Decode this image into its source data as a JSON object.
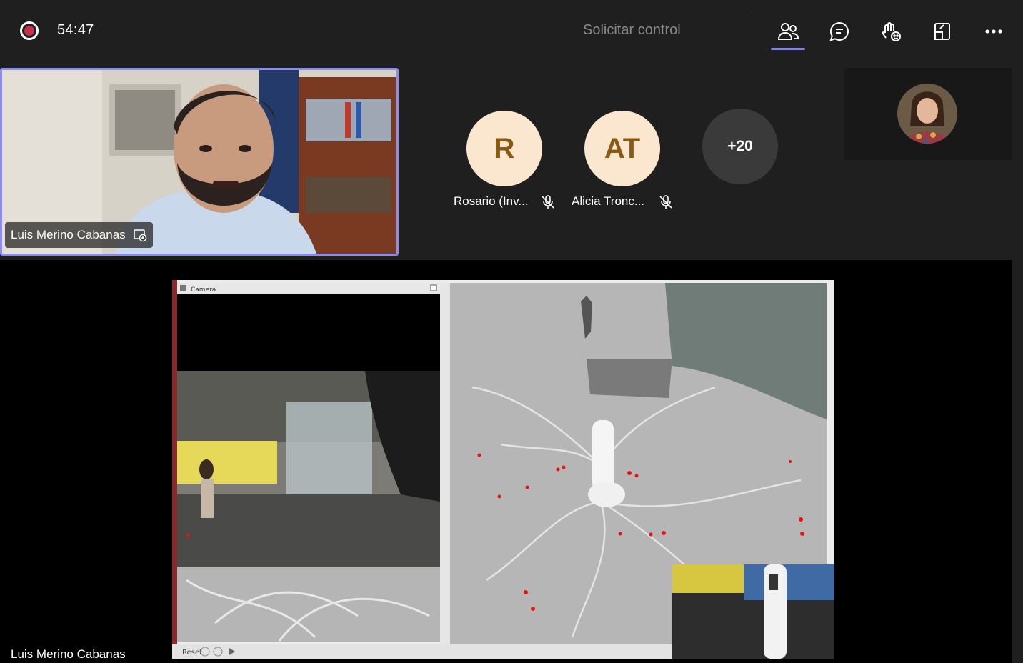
{
  "toolbar": {
    "recording_icon": "recording-dot-icon",
    "timer": "54:47",
    "request_control_label": "Solicitar control",
    "icons": [
      "people-icon",
      "chat-icon",
      "react-raise-hand-icon",
      "share-tray-icon",
      "more-options-icon"
    ],
    "active_color": "#7f85f5"
  },
  "gallery": {
    "speaker": {
      "name": "Luis Merino Cabanas",
      "badge_icon": "presenter-icon",
      "border_color": "#8b8cf0"
    },
    "participants": [
      {
        "initials": "R",
        "name": "Rosario (Inv...",
        "muted": true,
        "avatar_color": "#fbe7cf"
      },
      {
        "initials": "AT",
        "name": "Alicia Tronc...",
        "muted": true,
        "avatar_color": "#fbe7cf"
      }
    ],
    "overflow_count": "+20"
  },
  "shared_screen": {
    "presenter_name": "Luis Merino Cabanas",
    "camera_window_title": "Camera",
    "reset_label": "Reset"
  }
}
